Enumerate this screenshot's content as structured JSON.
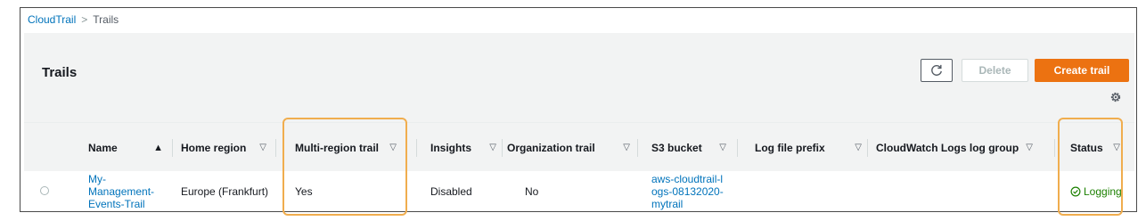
{
  "breadcrumb": {
    "root": "CloudTrail",
    "current": "Trails"
  },
  "panel": {
    "title": "Trails"
  },
  "toolbar": {
    "delete_label": "Delete",
    "create_label": "Create trail"
  },
  "table": {
    "columns": [
      "Name",
      "Home region",
      "Multi-region trail",
      "Insights",
      "Organization trail",
      "S3 bucket",
      "Log file prefix",
      "CloudWatch Logs log group",
      "Status"
    ],
    "sorted_column": "Name",
    "sort_direction": "ascending",
    "rows": [
      {
        "name": "My-Management-Events-Trail",
        "home_region": "Europe (Frankfurt)",
        "multi_region": "Yes",
        "insights": "Disabled",
        "organization": "No",
        "s3_bucket": "aws-cloudtrail-logs-08132020-mytrail",
        "log_prefix": "",
        "cloudwatch": "",
        "status": "Logging"
      }
    ]
  },
  "colors": {
    "accent": "#ec7211",
    "link": "#0073bb",
    "success": "#1d8102",
    "highlight": "#f0ad4e"
  },
  "icons": [
    "refresh-icon",
    "gear-icon",
    "sort-asc-icon",
    "sort-icon",
    "radio-icon",
    "check-circle-icon"
  ]
}
